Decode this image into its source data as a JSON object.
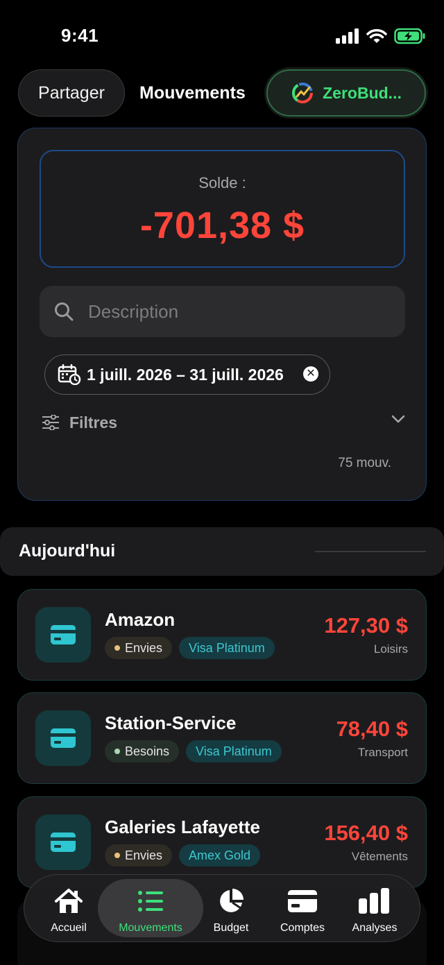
{
  "status_bar": {
    "time": "9:41"
  },
  "top_nav": {
    "share_label": "Partager",
    "title": "Mouvements",
    "brand_label": "ZeroBud..."
  },
  "summary": {
    "balance_label": "Solde :",
    "balance_value": "-701,38 $",
    "search_placeholder": "Description",
    "date_range": "1 juill. 2026 – 31 juill. 2026",
    "filters_label": "Filtres",
    "count_label": "75 mouv."
  },
  "section": {
    "title": "Aujourd'hui"
  },
  "transactions": [
    {
      "name": "Amazon",
      "tag": "Envies",
      "card": "Visa Platinum",
      "amount": "127,30 $",
      "category": "Loisirs"
    },
    {
      "name": "Station-Service",
      "tag": "Besoins",
      "card": "Visa Platinum",
      "amount": "78,40 $",
      "category": "Transport"
    },
    {
      "name": "Galeries Lafayette",
      "tag": "Envies",
      "card": "Amex Gold",
      "amount": "156,40 $",
      "category": "Vêtements"
    }
  ],
  "tab_bar": {
    "tabs": [
      {
        "label": "Accueil",
        "icon": "home-icon"
      },
      {
        "label": "Mouvements",
        "icon": "list-icon"
      },
      {
        "label": "Budget",
        "icon": "pie-chart-icon"
      },
      {
        "label": "Comptes",
        "icon": "credit-card-icon"
      },
      {
        "label": "Analyses",
        "icon": "bar-chart-icon"
      }
    ],
    "active": "Mouvements"
  },
  "colors": {
    "negative": "#ff453a",
    "accent_green": "#3ee07a",
    "teal": "#3ec7d1",
    "background": "#000000"
  }
}
